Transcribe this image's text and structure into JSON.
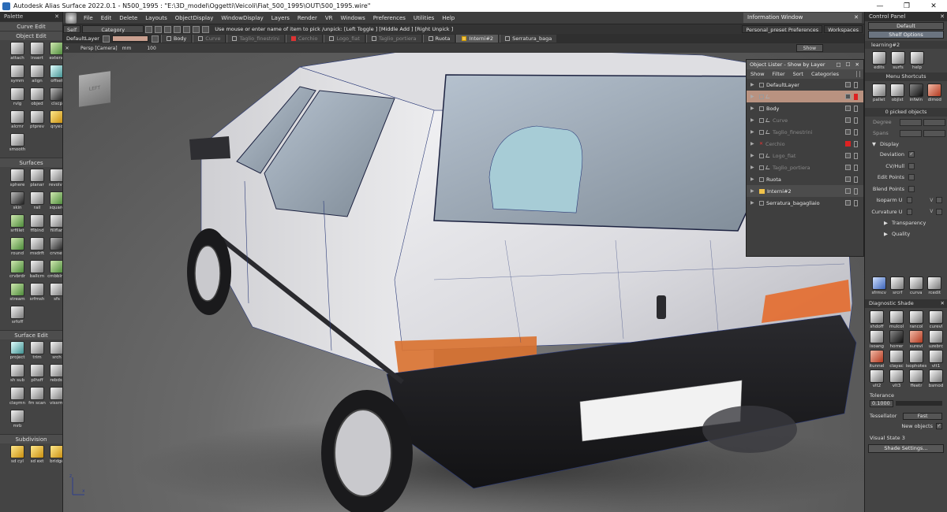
{
  "window": {
    "title": "Autodesk Alias Surface 2022.0.1   - N500_1995 : \"E:\\3D_model\\Oggetti\\Veicoli\\Fiat_500_1995\\OUT\\500_1995.wire\"",
    "minimize": "—",
    "maximize": "❐",
    "close": "✕"
  },
  "palette": {
    "title": "Palette",
    "close": "✕",
    "sections": [
      {
        "name": "Curve Edit",
        "tools": []
      },
      {
        "name": "Object Edit",
        "tools": [
          {
            "label": "attach",
            "style": "plain"
          },
          {
            "label": "insert",
            "style": "plain"
          },
          {
            "label": "extend",
            "style": "green"
          },
          {
            "label": "symm",
            "style": "plain"
          },
          {
            "label": "align",
            "style": "plain"
          },
          {
            "label": "offset",
            "style": "teal"
          },
          {
            "label": "rvlg",
            "style": "plain"
          },
          {
            "label": "objed",
            "style": "plain"
          },
          {
            "label": "clscp",
            "style": "dark"
          },
          {
            "label": "alcrnr",
            "style": "plain"
          },
          {
            "label": "ptprev",
            "style": "plain"
          },
          {
            "label": "qryed",
            "style": "yellow"
          },
          {
            "label": "smooth",
            "style": "plain"
          }
        ]
      },
      {
        "name": "Surfaces",
        "tools": [
          {
            "label": "sphere",
            "style": "plain"
          },
          {
            "label": "planar",
            "style": "plain"
          },
          {
            "label": "revolve",
            "style": "plain"
          },
          {
            "label": "skin",
            "style": "dark"
          },
          {
            "label": "rail",
            "style": "plain"
          },
          {
            "label": "square",
            "style": "green"
          },
          {
            "label": "srfillet",
            "style": "green"
          },
          {
            "label": "fflblnd",
            "style": "plain"
          },
          {
            "label": "fillflan",
            "style": "plain"
          },
          {
            "label": "round",
            "style": "green"
          },
          {
            "label": "msdrft",
            "style": "plain"
          },
          {
            "label": "crvnet",
            "style": "dark"
          },
          {
            "label": "crvbrdr",
            "style": "green"
          },
          {
            "label": "ballcrn",
            "style": "plain"
          },
          {
            "label": "cmbblnd",
            "style": "green"
          },
          {
            "label": "stream",
            "style": "green"
          },
          {
            "label": "srfmsh",
            "style": "plain"
          },
          {
            "label": "sfs",
            "style": "plain"
          },
          {
            "label": "srfoff",
            "style": "plain"
          }
        ]
      },
      {
        "name": "Surface Edit",
        "tools": [
          {
            "label": "project",
            "style": "teal"
          },
          {
            "label": "trim",
            "style": "plain"
          },
          {
            "label": "srch",
            "style": "plain"
          },
          {
            "label": "sh sub",
            "style": "plain"
          },
          {
            "label": "plhsff",
            "style": "plain"
          },
          {
            "label": "rebdsf",
            "style": "plain"
          },
          {
            "label": "claymn",
            "style": "plain"
          },
          {
            "label": "fm scan",
            "style": "plain"
          },
          {
            "label": "vissrm",
            "style": "plain"
          },
          {
            "label": "mrb",
            "style": "plain"
          }
        ]
      },
      {
        "name": "Subdivision",
        "tools": [
          {
            "label": "sd cyl",
            "style": "yellow"
          },
          {
            "label": "sd ext",
            "style": "yellow"
          },
          {
            "label": "bridge",
            "style": "yellow"
          }
        ]
      }
    ]
  },
  "menu": {
    "items": [
      "File",
      "Edit",
      "Delete",
      "Layouts",
      "ObjectDisplay",
      "WindowDisplay",
      "Layers",
      "Render",
      "VR",
      "Windows",
      "Preferences",
      "Utilities",
      "Help"
    ],
    "info_window": "Information Window",
    "info_close": "✕"
  },
  "toolbar": {
    "self": "Self",
    "category": "Category",
    "prompt": "Use mouse or enter name of item to pick /unpick: [Left Toggle ] [Middle Add ] [Right Unpick ]",
    "presets": "Personal_preset Preferences",
    "workspaces": "Workspaces"
  },
  "layer_bar": {
    "default_layer": "DefaultLayer",
    "layers": [
      {
        "name": "Body",
        "state": "normal"
      },
      {
        "name": "Curve",
        "state": "dim"
      },
      {
        "name": "Taglio_finestrini",
        "state": "dim"
      },
      {
        "name": "Cerchio",
        "state": "dim-red"
      },
      {
        "name": "Logo_fiat",
        "state": "dim"
      },
      {
        "name": "Taglio_portiera",
        "state": "dim"
      },
      {
        "name": "Ruota",
        "state": "normal"
      },
      {
        "name": "Interni#2",
        "state": "active"
      },
      {
        "name": "Serratura_baga",
        "state": "normal"
      }
    ]
  },
  "viewport": {
    "camera": "Persp [Camera]",
    "unit": "mm",
    "zoom": "100",
    "show": "Show",
    "cube_label": "LEFT",
    "axis_x": "x",
    "axis_z": "z"
  },
  "object_lister": {
    "title": "Object Lister - Show by Layer",
    "title_buttons": "□ ☐ ✕",
    "menu": [
      "Show",
      "Filter",
      "Sort",
      "Categories"
    ],
    "rows": [
      {
        "name": "DefaultLayer",
        "state": "normal",
        "vis": false,
        "extra": ""
      },
      {
        "name": "",
        "state": "selected",
        "vis": true,
        "extra": ""
      },
      {
        "name": "Body",
        "state": "normal",
        "vis": false,
        "extra": ""
      },
      {
        "name": "Curve",
        "state": "dim",
        "vis": true,
        "extra": ""
      },
      {
        "name": "Taglio_finestrini",
        "state": "dim",
        "vis": true,
        "extra": ""
      },
      {
        "name": "Cerchio",
        "state": "dim",
        "vis": false,
        "extra": "red"
      },
      {
        "name": "Logo_fiat",
        "state": "dim",
        "vis": true,
        "extra": ""
      },
      {
        "name": "Taglio_portiera",
        "state": "dim",
        "vis": true,
        "extra": ""
      },
      {
        "name": "Ruota",
        "state": "normal",
        "vis": false,
        "extra": ""
      },
      {
        "name": "Interni#2",
        "state": "hl",
        "vis": false,
        "extra": "folder"
      },
      {
        "name": "Serratura_bagagliaio",
        "state": "normal",
        "vis": false,
        "extra": ""
      }
    ]
  },
  "control_panel": {
    "title": "Control Panel",
    "close": "✕",
    "preset": "Default",
    "shelf_options": "Shelf Options",
    "shelf_name": "learning#2",
    "shelf_tools": [
      {
        "label": "edits",
        "style": "plain"
      },
      {
        "label": "surfs",
        "style": "plain"
      },
      {
        "label": "help",
        "style": "plain"
      }
    ],
    "menu_shortcuts": "Menu Shortcuts",
    "shortcut_tools": [
      {
        "label": "pallet",
        "style": "plain"
      },
      {
        "label": "objlst",
        "style": "plain"
      },
      {
        "label": "infwin",
        "style": "dark"
      },
      {
        "label": "dimod",
        "style": "red"
      }
    ],
    "picked": "0 picked objects",
    "degree": "Degree",
    "spans": "Spans",
    "display": "Display",
    "display_options": [
      {
        "name": "Deviation",
        "checked": true,
        "right": ""
      },
      {
        "name": "CV/Hull",
        "checked": false,
        "right": ""
      },
      {
        "name": "Edit Points",
        "checked": false,
        "right": ""
      },
      {
        "name": "Blend Points",
        "checked": false,
        "right": ""
      },
      {
        "name": "Isoparm U",
        "checked": false,
        "right": "V"
      },
      {
        "name": "Curvature U",
        "checked": false,
        "right": "V"
      }
    ],
    "transparency": "Transparency",
    "quality": "Quality",
    "bottom_tools": [
      {
        "label": "sfrmcv",
        "style": "blue"
      },
      {
        "label": "srcrf",
        "style": "plain"
      },
      {
        "label": "curva",
        "style": "plain"
      },
      {
        "label": "rcedit",
        "style": "plain"
      }
    ],
    "diag_title": "Diagnostic Shade",
    "diag_close": "✕",
    "diag_tools": [
      {
        "label": "shdoff",
        "style": "plain"
      },
      {
        "label": "mulcol",
        "style": "plain"
      },
      {
        "label": "rancol",
        "style": "yellow"
      },
      {
        "label": "curevl",
        "style": "yellow"
      },
      {
        "label": "isoang",
        "style": "plain"
      },
      {
        "label": "horrer",
        "style": "dark"
      },
      {
        "label": "surevl",
        "style": "red"
      },
      {
        "label": "uzebrc",
        "style": "plain"
      },
      {
        "label": "itunnel",
        "style": "red"
      },
      {
        "label": "clayac",
        "style": "plain"
      },
      {
        "label": "isophotes",
        "style": "plain"
      },
      {
        "label": "vlt1",
        "style": "plain"
      },
      {
        "label": "vlt2",
        "style": "plain"
      },
      {
        "label": "vlt3",
        "style": "plain"
      },
      {
        "label": "ffeetr",
        "style": "plain"
      },
      {
        "label": "bsmod",
        "style": "plain"
      }
    ],
    "tolerance": "Tolerance",
    "tolerance_value": "0.1000",
    "tessellator": "Tessellator",
    "tessellator_value": "Fast",
    "new_objects": "New objects",
    "visual_state": "Visual State 3",
    "shade_settings": "Shade Settings..."
  }
}
